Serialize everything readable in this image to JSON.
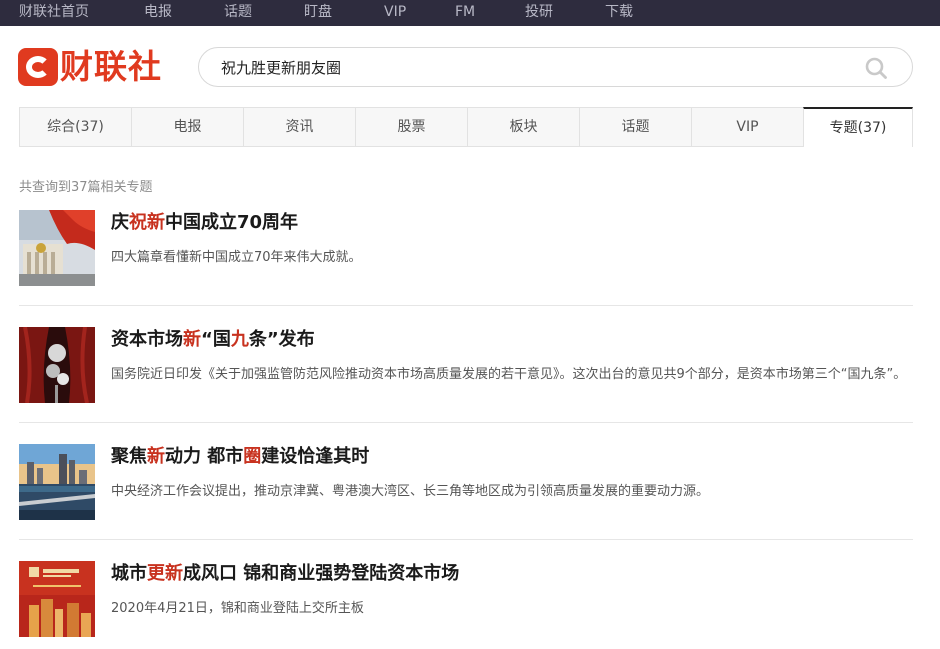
{
  "topnav": {
    "items": [
      "财联社首页",
      "电报",
      "话题",
      "盯盘",
      "VIP",
      "FM",
      "投研",
      "下载"
    ]
  },
  "logo": {
    "text": "财联社",
    "icon": "cls-logo-icon",
    "color": "#e03a1f"
  },
  "search": {
    "value": "祝九胜更新朋友圈",
    "icon": "search-icon"
  },
  "tabs": [
    {
      "label": "综合(37)"
    },
    {
      "label": "电报"
    },
    {
      "label": "资讯"
    },
    {
      "label": "股票"
    },
    {
      "label": "板块"
    },
    {
      "label": "话题"
    },
    {
      "label": "VIP"
    },
    {
      "label": "专题(37)",
      "active": true
    }
  ],
  "summary": "共查询到37篇相关专题",
  "highlight_color": "#c8321f",
  "results": [
    {
      "title_parts": [
        {
          "t": "庆"
        },
        {
          "t": "祝新",
          "hl": true
        },
        {
          "t": "中国成立70周年"
        }
      ],
      "desc": "四大篇章看懂新中国成立70年来伟大成就。",
      "thumb": "national-day-thumb"
    },
    {
      "title_parts": [
        {
          "t": "资本市场"
        },
        {
          "t": "新",
          "hl": true
        },
        {
          "t": "“国"
        },
        {
          "t": "九",
          "hl": true
        },
        {
          "t": "条”发布"
        }
      ],
      "desc": "国务院近日印发《关于加强监管防范风险推动资本市场高质量发展的若干意见》。这次出台的意见共9个部分，是资本市场第三个“国九条”。",
      "thumb": "curtain-thumb"
    },
    {
      "title_parts": [
        {
          "t": "聚焦"
        },
        {
          "t": "新",
          "hl": true
        },
        {
          "t": "动力 都市"
        },
        {
          "t": "圈",
          "hl": true
        },
        {
          "t": "建设恰逢其时"
        }
      ],
      "desc": "中央经济工作会议提出，推动京津冀、粤港澳大湾区、长三角等地区成为引领高质量发展的重要动力源。",
      "thumb": "city-skyline-thumb"
    },
    {
      "title_parts": [
        {
          "t": "城市"
        },
        {
          "t": "更新",
          "hl": true
        },
        {
          "t": "成风口 锦和商业强势登陆资本市场"
        }
      ],
      "desc": "2020年4月21日，锦和商业登陆上交所主板",
      "thumb": "ipo-poster-thumb"
    }
  ]
}
